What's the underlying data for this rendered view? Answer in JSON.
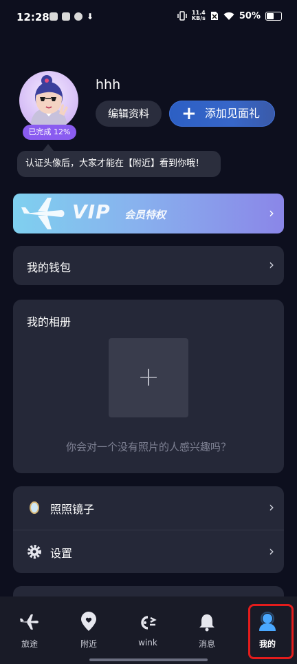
{
  "status_bar": {
    "time": "12:28",
    "speed_value": "11.4",
    "speed_unit": "KB/s",
    "battery": "50%"
  },
  "profile": {
    "username": "hhh",
    "progress_label": "已完成 12%",
    "progress_value": 0.12,
    "edit_button": "编辑资料",
    "gift_button": "添加见面礼",
    "tooltip": "认证头像后，大家才能在【附近】看到你哦！"
  },
  "vip": {
    "title": "VIP",
    "subtitle": "会员特权"
  },
  "wallet": {
    "label": "我的钱包"
  },
  "album": {
    "title": "我的相册",
    "empty_tip": "你会对一个没有照片的人感兴趣吗？"
  },
  "menu": {
    "items": [
      {
        "label": "照照镜子",
        "icon": "mirror-icon"
      },
      {
        "label": "设置",
        "icon": "gear-icon"
      }
    ]
  },
  "tabs": [
    {
      "label": "旅途",
      "icon": "airplane-icon",
      "active": false
    },
    {
      "label": "附近",
      "icon": "location-heart-icon",
      "active": false
    },
    {
      "label": "wink",
      "icon": "wink-icon",
      "active": false
    },
    {
      "label": "消息",
      "icon": "bell-icon",
      "active": false
    },
    {
      "label": "我的",
      "icon": "profile-icon",
      "active": true
    }
  ],
  "colors": {
    "background": "#0d0f1e",
    "card": "#252838",
    "accent": "#8a5cf0",
    "active_tab_icon": "#4aa8ff",
    "highlight_frame": "#e31c1c"
  }
}
